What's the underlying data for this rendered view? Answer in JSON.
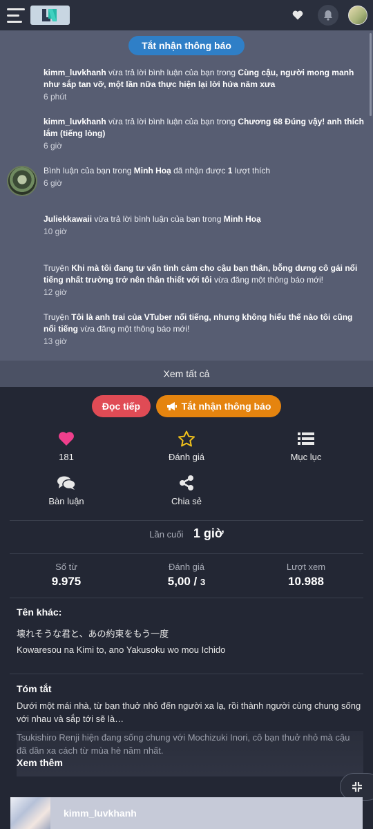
{
  "header": {
    "menu_icon": "hamburger-icon",
    "logo_icon": "logo-icon",
    "favorites_icon": "heart-icon",
    "notifications_icon": "bell-icon"
  },
  "notifications": {
    "toggle_label": "Tắt nhận thông báo",
    "items": [
      {
        "user": "kimm_luvkhanh",
        "action": "vừa trả lời bình luận của bạn trong",
        "target": "Cùng cậu, người mong manh như sắp tan vỡ, một lần nữa thực hiện lại lời hứa năm xưa",
        "time": "6 phút"
      },
      {
        "user": "kimm_luvkhanh",
        "action": "vừa trả lời bình luận của bạn trong",
        "target": "Chương 68 Đúng vậy! anh thích lắm (tiếng lòng)",
        "time": "6 giờ"
      },
      {
        "prefix": "Bình luận của bạn trong",
        "target": "Minh Hoạ",
        "middle": "đã nhận được",
        "count": "1",
        "suffix": "lượt thích",
        "time": "6 giờ"
      },
      {
        "user": "Juliekkawaii",
        "action": "vừa trả lời bình luận của bạn trong",
        "target": "Minh Hoạ",
        "time": "10 giờ"
      },
      {
        "prefix": "Truyện",
        "target": "Khi mà tôi đang tư vấn tình cảm cho cậu bạn thân, bỗng dưng cô gái nổi tiếng nhất trường trở nên thân thiết với tôi",
        "suffix": "vừa đăng một thông báo mới!",
        "time": "12 giờ"
      },
      {
        "prefix": "Truyện",
        "target": "Tôi là anh trai của VTuber nổi tiếng, nhưng không hiểu thế nào tôi cũng nổi tiếng",
        "suffix": "vừa đăng một thông báo mới!",
        "time": "13 giờ"
      }
    ],
    "see_all": "Xem tất cả"
  },
  "actions": {
    "read_label": "Đọc tiếp",
    "unsub_label": "Tắt nhận thông báo"
  },
  "features": {
    "likes": "181",
    "rate": "Đánh giá",
    "toc": "Mục lục",
    "discuss": "Bàn luận",
    "share": "Chia sẻ"
  },
  "info": {
    "last_label": "Lần cuối",
    "last_value": "1 giờ",
    "words_label": "Số từ",
    "words_value": "9.975",
    "rating_label": "Đánh giá",
    "rating_value": "5,00 /",
    "rating_count": "3",
    "views_label": "Lượt xem",
    "views_value": "10.988"
  },
  "other_names": {
    "title": "Tên khác:",
    "names": [
      "壊れそうな君と、あの約束をもう一度",
      "Kowaresou na Kimi to, ano Yakusoku wo mou Ichido"
    ]
  },
  "summary": {
    "title": "Tóm tắt",
    "text1": "Dưới một mái nhà, từ bạn thuở nhỏ đến người xa lạ, rồi thành người cùng chung sống với nhau và sắp tới sẽ là…",
    "text2": "Tsukishiro Renji hiện đang sống chung với Mochizuki Inori, cô bạn thuở nhỏ mà cậu đã dần xa cách từ mùa hè năm nhất.",
    "see_more": "Xem thêm"
  },
  "uploader": {
    "name": "kimm_luvkhanh"
  },
  "colors": {
    "accent_blue": "#2f7fc7",
    "read_red": "#e04b55",
    "unsub_orange": "#e5840f",
    "heart_pink": "#ef3f8c",
    "star_yellow": "#f2c21b"
  }
}
